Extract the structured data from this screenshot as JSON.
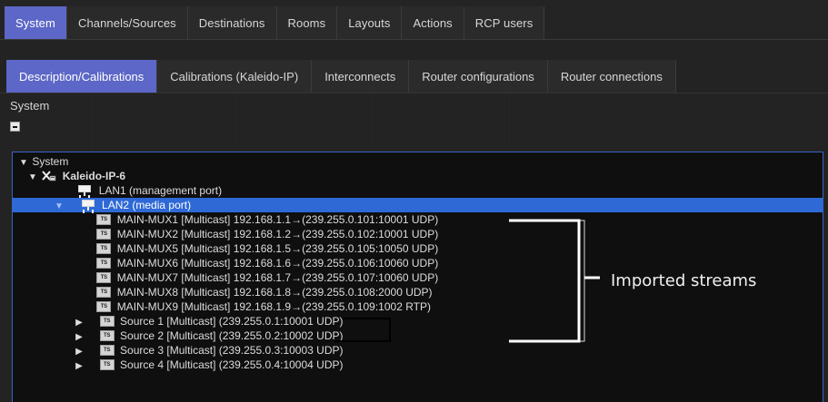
{
  "top_tabs": [
    {
      "label": "System",
      "active": true
    },
    {
      "label": "Channels/Sources",
      "active": false
    },
    {
      "label": "Destinations",
      "active": false
    },
    {
      "label": "Rooms",
      "active": false
    },
    {
      "label": "Layouts",
      "active": false
    },
    {
      "label": "Actions",
      "active": false
    },
    {
      "label": "RCP users",
      "active": false
    }
  ],
  "sub_tabs": [
    {
      "label": "Description/Calibrations",
      "active": true
    },
    {
      "label": "Calibrations (Kaleido-IP)",
      "active": false
    },
    {
      "label": "Interconnects",
      "active": false
    },
    {
      "label": "Router configurations",
      "active": false
    },
    {
      "label": "Router connections",
      "active": false
    }
  ],
  "system_section": {
    "label": "System"
  },
  "tree": {
    "root": {
      "label": "System",
      "expanded": true
    },
    "device": {
      "label": "Kaleido-IP-6",
      "icon": "multiviewer-icon",
      "expanded": true
    },
    "ports": [
      {
        "label": "LAN1 (management port)",
        "icon": "network-port-icon",
        "selected": false
      },
      {
        "label": "LAN2 (media port)",
        "icon": "network-port-icon",
        "selected": true,
        "expanded": true
      }
    ],
    "streams": [
      {
        "label": "MAIN-MUX1 [Multicast] 192.168.1.1→(239.255.0.101:10001 UDP)",
        "icon": "ts-stream-icon"
      },
      {
        "label": "MAIN-MUX2 [Multicast] 192.168.1.2→(239.255.0.102:10001 UDP)",
        "icon": "ts-stream-icon"
      },
      {
        "label": "MAIN-MUX5 [Multicast] 192.168.1.5→(239.255.0.105:10050 UDP)",
        "icon": "ts-stream-icon"
      },
      {
        "label": "MAIN-MUX6 [Multicast] 192.168.1.6→(239.255.0.106:10060 UDP)",
        "icon": "ts-stream-icon"
      },
      {
        "label": "MAIN-MUX7 [Multicast] 192.168.1.7→(239.255.0.107:10060 UDP)",
        "icon": "ts-stream-icon"
      },
      {
        "label": "MAIN-MUX8 [Multicast] 192.168.1.8→(239.255.0.108:2000 UDP)",
        "icon": "ts-stream-icon"
      },
      {
        "label": "MAIN-MUX9 [Multicast] 192.168.1.9→(239.255.0.109:1002 RTP)",
        "icon": "ts-stream-icon"
      }
    ],
    "sources": [
      {
        "label": "Source 1 [Multicast] (239.255.0.1:10001 UDP)",
        "icon": "ts-stream-icon",
        "collapsed": true
      },
      {
        "label": "Source 2 [Multicast] (239.255.0.2:10002 UDP)",
        "icon": "ts-stream-icon",
        "collapsed": true
      },
      {
        "label": "Source 3 [Multicast] (239.255.0.3:10003 UDP)",
        "icon": "ts-stream-icon",
        "collapsed": true
      },
      {
        "label": "Source 4 [Multicast] (239.255.0.4:10004 UDP)",
        "icon": "ts-stream-icon",
        "collapsed": true
      }
    ]
  },
  "annotation": {
    "label": "Imported streams"
  },
  "icons": {
    "stream_icon_text": "TS"
  },
  "colors": {
    "accent": "#5c67c7",
    "selection": "#2e69d6",
    "background": "#232323",
    "tree_background": "#0f0f0f"
  }
}
